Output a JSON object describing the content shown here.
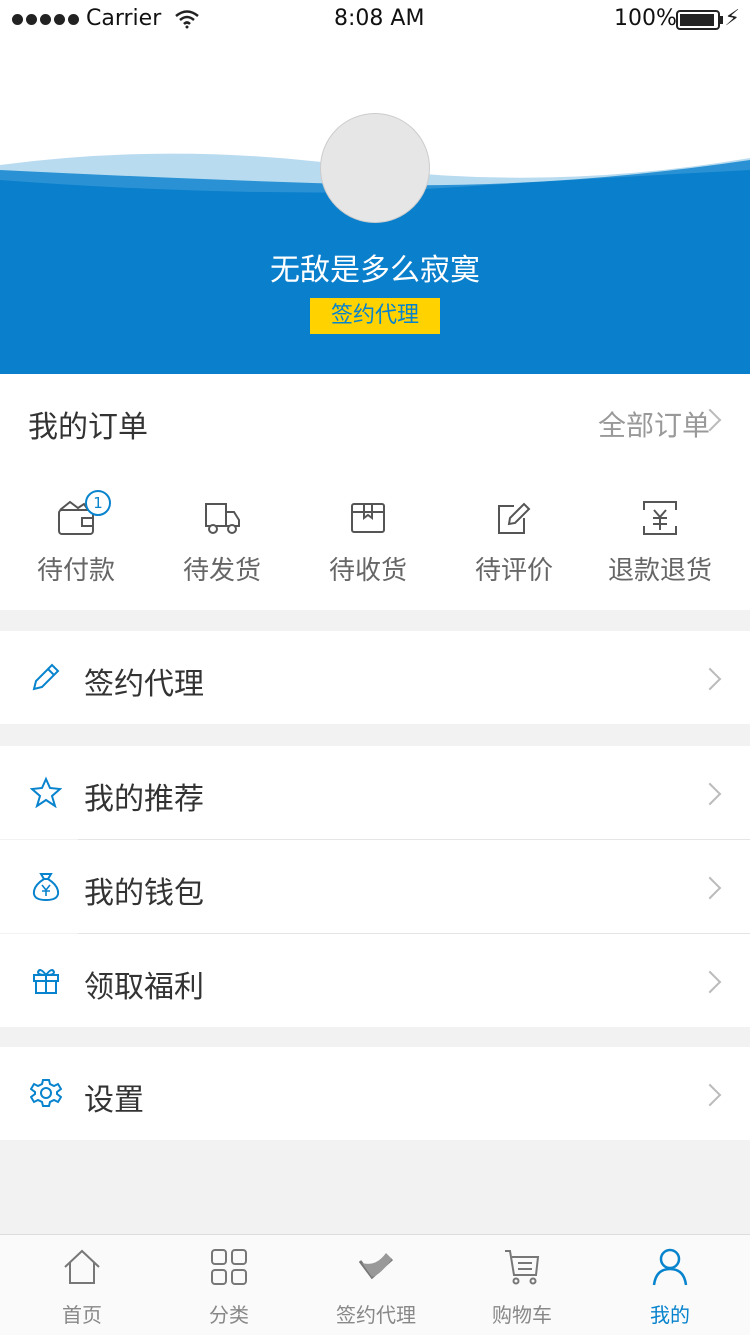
{
  "status_bar": {
    "carrier": "Carrier",
    "time": "8:08 AM",
    "battery": "100%"
  },
  "header": {
    "username": "无敌是多么寂寞",
    "agent_button": "签约代理",
    "colors": {
      "blue": "#0883CD",
      "yellow": "#FFD200"
    }
  },
  "orders": {
    "title": "我的订单",
    "view_all": "全部订单",
    "items": [
      {
        "icon": "wallet-icon",
        "label": "待付款",
        "badge": "1"
      },
      {
        "icon": "truck-icon",
        "label": "待发货"
      },
      {
        "icon": "box-icon",
        "label": "待收货"
      },
      {
        "icon": "edit-icon",
        "label": "待评价"
      },
      {
        "icon": "refund-icon",
        "label": "退款退货"
      }
    ]
  },
  "menu": {
    "agent": {
      "icon": "pencil-icon",
      "label": "签约代理"
    },
    "recommend": {
      "icon": "star-icon",
      "label": "我的推荐"
    },
    "wallet": {
      "icon": "money-bag-icon",
      "label": "我的钱包"
    },
    "welfare": {
      "icon": "gift-icon",
      "label": "领取福利"
    },
    "settings": {
      "icon": "gear-icon",
      "label": "设置"
    }
  },
  "tabbar": {
    "active": "我的",
    "items": [
      {
        "icon": "home-icon",
        "label": "首页"
      },
      {
        "icon": "grid-icon",
        "label": "分类"
      },
      {
        "icon": "agent-icon",
        "label": "签约代理"
      },
      {
        "icon": "cart-icon",
        "label": "购物车"
      },
      {
        "icon": "user-icon",
        "label": "我的"
      }
    ]
  }
}
